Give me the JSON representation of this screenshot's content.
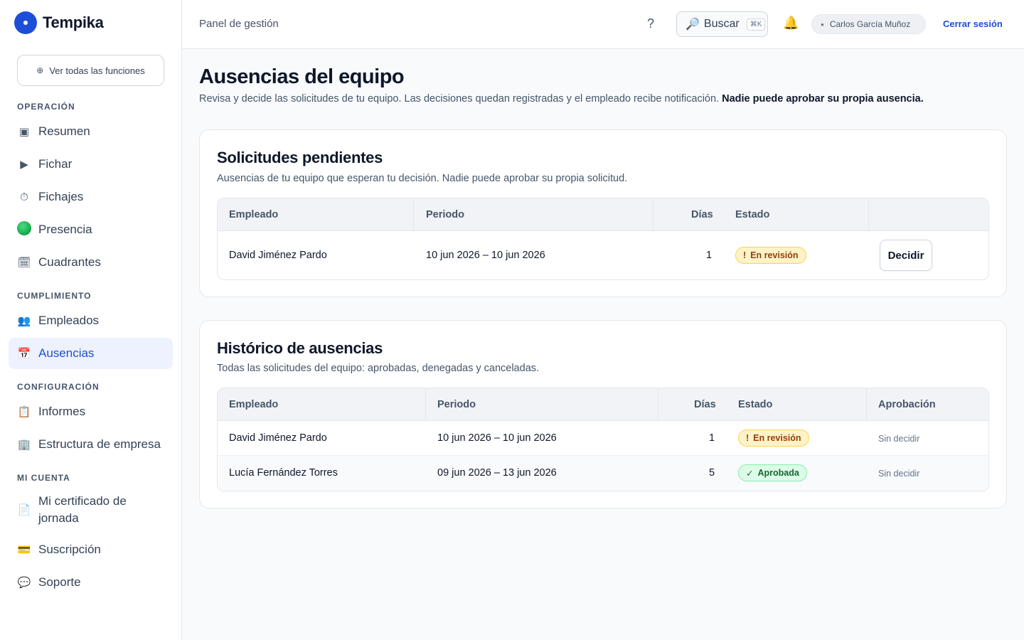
{
  "brand": {
    "name": "Tempika"
  },
  "sidebar": {
    "all_features_label": "Ver todas las funciones",
    "sections": [
      {
        "title": "OPERACIÓN",
        "items": [
          {
            "label": "Resumen",
            "icon": "square-icon"
          },
          {
            "label": "Fichar",
            "icon": "play-icon"
          },
          {
            "label": "Fichajes",
            "icon": "stopwatch-icon"
          },
          {
            "label": "Presencia",
            "icon": "green-circle-icon"
          },
          {
            "label": "Cuadrantes",
            "icon": "calendar-icon"
          }
        ]
      },
      {
        "title": "CUMPLIMIENTO",
        "items": [
          {
            "label": "Empleados",
            "icon": "people-icon"
          },
          {
            "label": "Ausencias",
            "icon": "calendar-icon",
            "active": true
          }
        ]
      },
      {
        "title": "CONFIGURACIÓN",
        "items": [
          {
            "label": "Informes",
            "icon": "clipboard-icon"
          },
          {
            "label": "Estructura de empresa",
            "icon": "building-icon"
          }
        ]
      },
      {
        "title": "MI CUENTA",
        "items": [
          {
            "label": "Mi certificado de jornada",
            "icon": "document-icon"
          },
          {
            "label": "Suscripción",
            "icon": "credit-card-icon"
          },
          {
            "label": "Soporte",
            "icon": "speech-bubble-icon"
          }
        ]
      }
    ]
  },
  "header": {
    "breadcrumb": "Panel de gestión",
    "help": "?",
    "search_label": "Buscar",
    "search_shortcut": "⌘K",
    "user_name": "Carlos García Muñoz",
    "logout_label": "Cerrar sesión"
  },
  "page": {
    "title": "Ausencias del equipo",
    "description": "Revisa y decide las solicitudes de tu equipo. Las decisiones quedan registradas y el empleado recibe notificación.",
    "description_strong": "Nadie puede aprobar su propia ausencia."
  },
  "pending": {
    "title": "Solicitudes pendientes",
    "description": "Ausencias de tu equipo que esperan tu decisión. Nadie puede aprobar su propia solicitud.",
    "columns": [
      "Empleado",
      "Periodo",
      "Días",
      "Estado"
    ],
    "rows": [
      {
        "employee": "David Jiménez Pardo",
        "period": "10 jun 2026 – 10 jun 2026",
        "days": "1",
        "status": "En revisión",
        "status_icon": "!",
        "action": "Decidir"
      }
    ]
  },
  "history": {
    "title": "Histórico de ausencias",
    "description": "Todas las solicitudes del equipo: aprobadas, denegadas y canceladas.",
    "columns": [
      "Empleado",
      "Periodo",
      "Días",
      "Estado",
      "Aprobación"
    ],
    "rows": [
      {
        "employee": "David Jiménez Pardo",
        "period": "10 jun 2026 – 10 jun 2026",
        "days": "1",
        "status": "En revisión",
        "status_icon": "!",
        "approval": "Sin decidir"
      },
      {
        "employee": "Lucía Fernández Torres",
        "period": "09 jun 2026 – 13 jun 2026",
        "days": "5",
        "status": "Aprobada",
        "status_icon": "✓",
        "approval": "Sin decidir"
      }
    ]
  },
  "colors": {
    "accent": "#1d4ed8",
    "review": "#fef3c7",
    "approved": "#dcfce7"
  }
}
